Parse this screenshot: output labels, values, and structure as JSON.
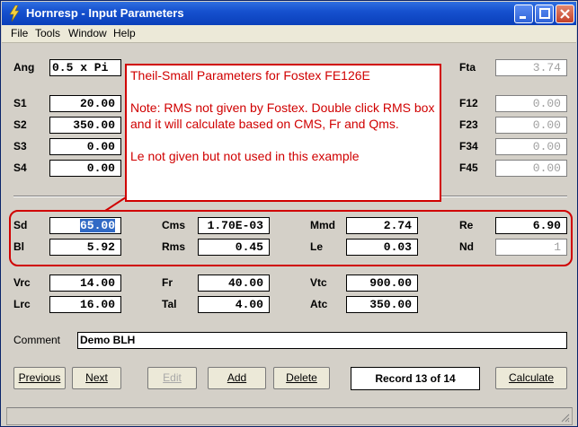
{
  "window": {
    "title": "Hornresp - Input Parameters"
  },
  "menu": [
    "File",
    "Tools",
    "Window",
    "Help"
  ],
  "top": {
    "ang": {
      "label": "Ang",
      "value": "0.5 x Pi"
    },
    "fta": {
      "label": "Fta",
      "value": "3.74"
    }
  },
  "s_rows": [
    {
      "label": "S1",
      "value": "20.00",
      "f_label": "F12",
      "f_value": "0.00"
    },
    {
      "label": "S2",
      "value": "350.00",
      "f_label": "F23",
      "f_value": "0.00"
    },
    {
      "label": "S3",
      "value": "0.00",
      "f_label": "F34",
      "f_value": "0.00"
    },
    {
      "label": "S4",
      "value": "0.00",
      "f_label": "F45",
      "f_value": "0.00"
    }
  ],
  "driver": {
    "sd": {
      "label": "Sd",
      "value": "65.00"
    },
    "cms": {
      "label": "Cms",
      "value": "1.70E-03"
    },
    "mmd": {
      "label": "Mmd",
      "value": "2.74"
    },
    "re": {
      "label": "Re",
      "value": "6.90"
    },
    "bl": {
      "label": "Bl",
      "value": "5.92"
    },
    "rms": {
      "label": "Rms",
      "value": "0.45"
    },
    "le": {
      "label": "Le",
      "value": "0.03"
    },
    "nd": {
      "label": "Nd",
      "value": "1"
    }
  },
  "chamber": {
    "vrc": {
      "label": "Vrc",
      "value": "14.00"
    },
    "fr": {
      "label": "Fr",
      "value": "40.00"
    },
    "vtc": {
      "label": "Vtc",
      "value": "900.00"
    },
    "lrc": {
      "label": "Lrc",
      "value": "16.00"
    },
    "tal": {
      "label": "Tal",
      "value": "4.00"
    },
    "atc": {
      "label": "Atc",
      "value": "350.00"
    }
  },
  "comment": {
    "label": "Comment",
    "value": "Demo BLH"
  },
  "callout": {
    "title": "Theil-Small Parameters for Fostex FE126E",
    "note1": "Note: RMS not given by Fostex. Double click RMS box and it will calculate based on CMS, Fr and Qms.",
    "note2": "Le not given but not used in this example"
  },
  "buttons": {
    "previous": "Previous",
    "next": "Next",
    "edit": "Edit",
    "add": "Add",
    "delete": "Delete",
    "calculate": "Calculate"
  },
  "record": "Record 13 of 14",
  "colors": {
    "annotation": "#d00000",
    "titlebar": "#1651cf",
    "selection": "#316ac5"
  }
}
